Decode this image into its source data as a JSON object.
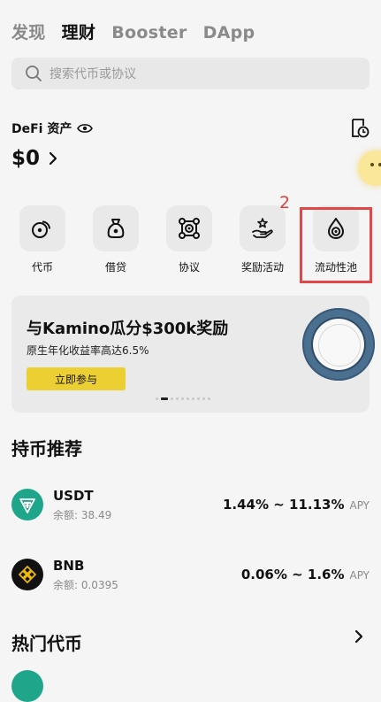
{
  "nav": {
    "tabs": [
      {
        "label": "发现",
        "active": false
      },
      {
        "label": "理财",
        "active": true
      },
      {
        "label": "Booster",
        "active": false
      },
      {
        "label": "DApp",
        "active": false
      }
    ]
  },
  "search": {
    "placeholder": "搜索代币或协议",
    "icon": "search-icon"
  },
  "defi": {
    "title": "DeFi 资产",
    "visibility_icon": "eye-icon",
    "balance": "$0",
    "history_icon": "history-clock-icon"
  },
  "actions": [
    {
      "label": "代币",
      "icon": "token-coins-icon"
    },
    {
      "label": "借贷",
      "icon": "money-bag-icon"
    },
    {
      "label": "协议",
      "icon": "protocol-icon"
    },
    {
      "label": "奖励活动",
      "icon": "reward-hand-icon"
    },
    {
      "label": "流动性池",
      "icon": "liquidity-drop-icon"
    }
  ],
  "annotation": {
    "marker": "2",
    "color": "#e04848"
  },
  "banner": {
    "title": "与Kamino瓜分$300k奖励",
    "subtitle": "原生年化收益率高达6.5%",
    "button": "立即参与",
    "accent": "#ecd033",
    "slide_count": 10,
    "active_slide": 2
  },
  "recommended": {
    "title": "持币推荐",
    "coins": [
      {
        "symbol": "USDT",
        "balance": "余额: 38.49",
        "apy": "1.44% ~ 11.13%",
        "unit": "APY",
        "color": "#1fa68a"
      },
      {
        "symbol": "BNB",
        "balance": "余额: 0.0395",
        "apy": "0.06% ~ 1.6%",
        "unit": "APY",
        "color": "#111111"
      }
    ]
  },
  "hot": {
    "title": "热门代币"
  }
}
